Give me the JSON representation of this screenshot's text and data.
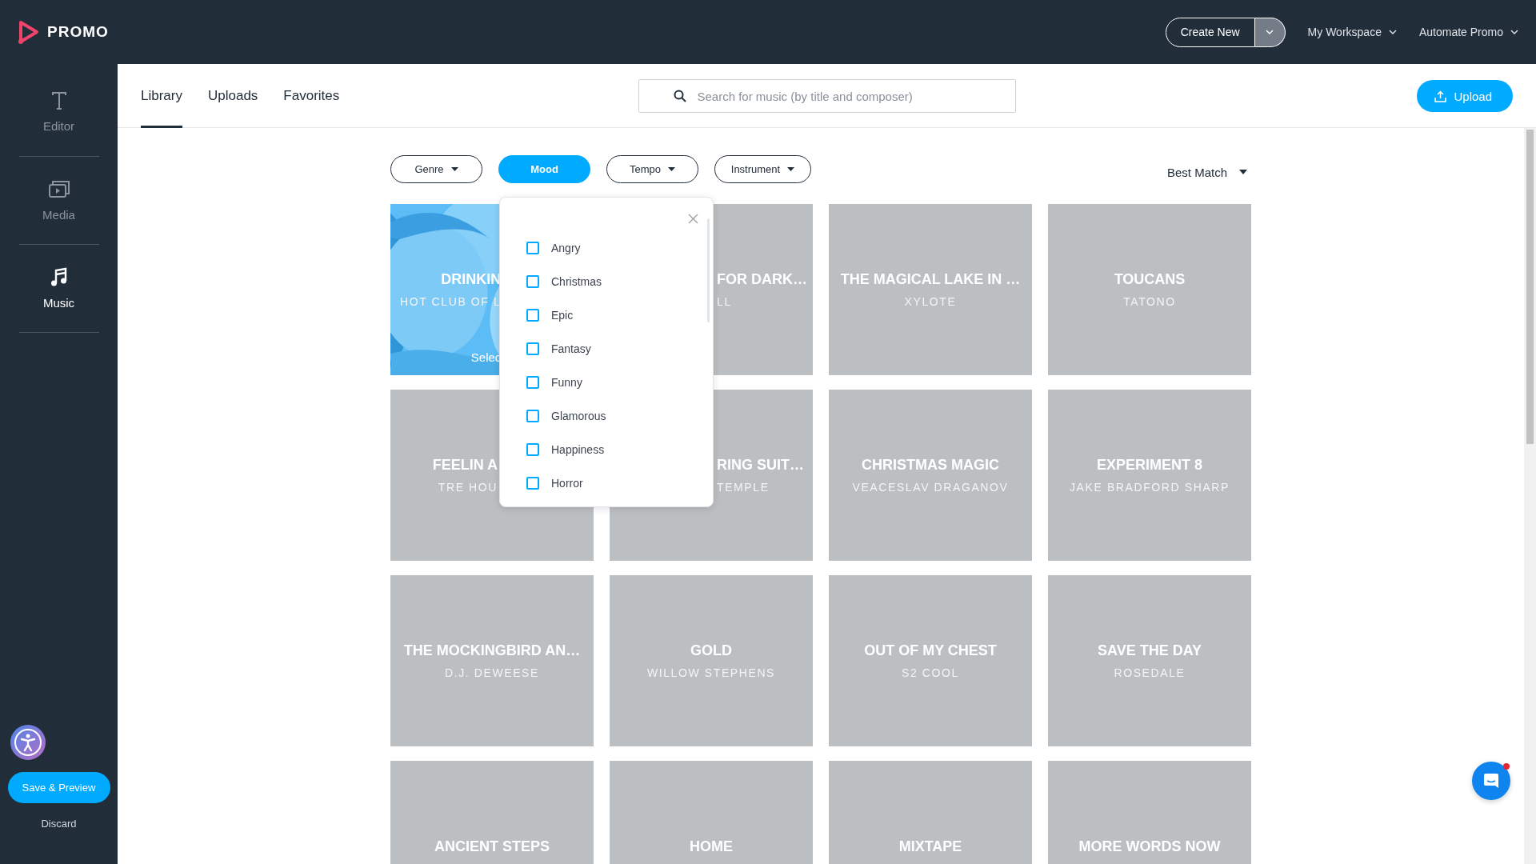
{
  "top_bar": {
    "logo_text": "PROMO",
    "create_button": "Create New",
    "menus": [
      "My Workspace",
      "Automate Promo"
    ]
  },
  "sidebar": {
    "items": [
      {
        "label": "Editor",
        "selected": false
      },
      {
        "label": "Media",
        "selected": false
      },
      {
        "label": "Music",
        "selected": true
      }
    ],
    "save_button": "Save & Preview",
    "discard_button": "Discard"
  },
  "tabs": [
    {
      "label": "Library",
      "selected": true
    },
    {
      "label": "Uploads",
      "selected": false
    },
    {
      "label": "Favorites",
      "selected": false
    }
  ],
  "search": {
    "placeholder": "Search for music (by title and composer)"
  },
  "upload_button": "Upload",
  "filters": [
    {
      "label": "Genre",
      "selected": false
    },
    {
      "label": "Mood",
      "selected": true
    },
    {
      "label": "Tempo",
      "selected": false
    },
    {
      "label": "Instrument",
      "selected": false
    }
  ],
  "sort": "Best Match",
  "mood_dropdown": {
    "options": [
      {
        "label": "Angry",
        "checked": false
      },
      {
        "label": "Christmas",
        "checked": false
      },
      {
        "label": "Epic",
        "checked": false
      },
      {
        "label": "Fantasy",
        "checked": false
      },
      {
        "label": "Funny",
        "checked": false
      },
      {
        "label": "Glamorous",
        "checked": false
      },
      {
        "label": "Happiness",
        "checked": false
      },
      {
        "label": "Horror",
        "checked": false
      }
    ]
  },
  "tracks": [
    {
      "kind": "picture",
      "title": "DRINKIN",
      "artist": "HOT CLUB OF L",
      "action": "Selec",
      "cut_end": true
    },
    {
      "kind": "plain",
      "title": "FOR DARK…",
      "artist": "LL",
      "cut_start": true
    },
    {
      "kind": "plain",
      "title": "THE MAGICAL LAKE IN …",
      "artist": "XYLOTE"
    },
    {
      "kind": "plain",
      "title": "TOUCANS",
      "artist": "TATONO"
    },
    {
      "kind": "plain",
      "title": "FEELIN A",
      "artist": "TRE HOU",
      "cut_end": true
    },
    {
      "kind": "plain",
      "title": "RING SUIT…",
      "artist": "TEMPLE",
      "cut_start": true
    },
    {
      "kind": "plain",
      "title": "CHRISTMAS MAGIC",
      "artist": "VEACESLAV DRAGANOV"
    },
    {
      "kind": "plain",
      "title": "EXPERIMENT 8",
      "artist": "JAKE BRADFORD SHARP"
    },
    {
      "kind": "plain",
      "title": "THE MOCKINGBIRD AN…",
      "artist": "D.J. DEWEESE"
    },
    {
      "kind": "plain",
      "title": "GOLD",
      "artist": "WILLOW STEPHENS"
    },
    {
      "kind": "plain",
      "title": "OUT OF MY CHEST",
      "artist": "S2 COOL"
    },
    {
      "kind": "plain",
      "title": "SAVE THE DAY",
      "artist": "ROSEDALE"
    },
    {
      "kind": "plain",
      "title": "ANCIENT STEPS"
    },
    {
      "kind": "plain",
      "title": "HOME"
    },
    {
      "kind": "plain",
      "title": "MIXTAPE"
    },
    {
      "kind": "plain",
      "title": "MORE WORDS NOW"
    }
  ]
}
